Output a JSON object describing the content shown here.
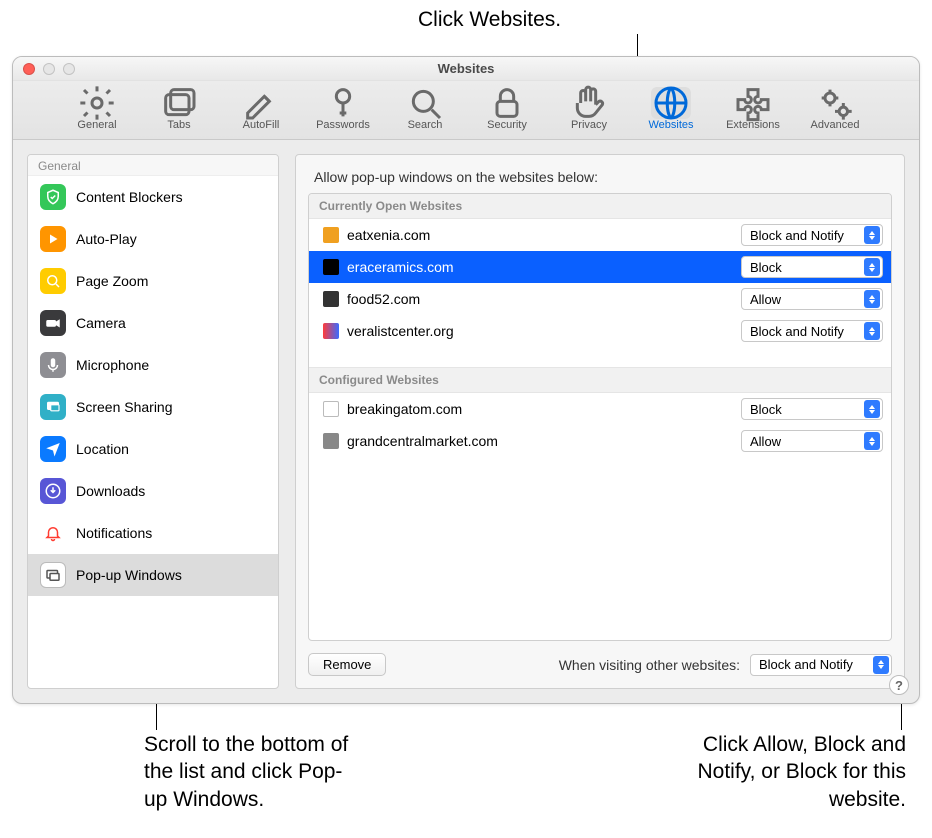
{
  "annotations": {
    "top": "Click Websites.",
    "bottom_left": "Scroll to the bottom of the list and click Pop-up Windows.",
    "bottom_right": "Click Allow, Block and Notify, or Block for this website."
  },
  "window": {
    "title": "Websites",
    "help_label": "?"
  },
  "toolbar": [
    {
      "id": "general",
      "label": "General"
    },
    {
      "id": "tabs",
      "label": "Tabs"
    },
    {
      "id": "autofill",
      "label": "AutoFill"
    },
    {
      "id": "passwords",
      "label": "Passwords"
    },
    {
      "id": "search",
      "label": "Search"
    },
    {
      "id": "security",
      "label": "Security"
    },
    {
      "id": "privacy",
      "label": "Privacy"
    },
    {
      "id": "websites",
      "label": "Websites",
      "active": true
    },
    {
      "id": "extensions",
      "label": "Extensions"
    },
    {
      "id": "advanced",
      "label": "Advanced"
    }
  ],
  "sidebar": {
    "header": "General",
    "items": [
      {
        "id": "content-blockers",
        "label": "Content Blockers",
        "color": "#34c759"
      },
      {
        "id": "auto-play",
        "label": "Auto-Play",
        "color": "#ff9500"
      },
      {
        "id": "page-zoom",
        "label": "Page Zoom",
        "color": "#ffcc00"
      },
      {
        "id": "camera",
        "label": "Camera",
        "color": "#3a3a3c"
      },
      {
        "id": "microphone",
        "label": "Microphone",
        "color": "#8e8e93"
      },
      {
        "id": "screen-sharing",
        "label": "Screen Sharing",
        "color": "#30b0c7"
      },
      {
        "id": "location",
        "label": "Location",
        "color": "#0a7aff"
      },
      {
        "id": "downloads",
        "label": "Downloads",
        "color": "#5856d6"
      },
      {
        "id": "notifications",
        "label": "Notifications",
        "color": "#ff3b30"
      },
      {
        "id": "popup-windows",
        "label": "Pop-up Windows",
        "color": "#d1d1d6",
        "selected": true
      }
    ]
  },
  "main": {
    "heading": "Allow pop-up windows on the websites below:",
    "sections": {
      "open_label": "Currently Open Websites",
      "configured_label": "Configured Websites"
    },
    "open_sites": [
      {
        "domain": "eatxenia.com",
        "policy": "Block and Notify",
        "favicon": "#f0a020"
      },
      {
        "domain": "eraceramics.com",
        "policy": "Block",
        "favicon": "#000",
        "selected": true
      },
      {
        "domain": "food52.com",
        "policy": "Allow",
        "favicon": "#333"
      },
      {
        "domain": "veralistcenter.org",
        "policy": "Block and Notify",
        "favicon": "linear-gradient(90deg,#ff3b3b,#3b6bff)"
      }
    ],
    "configured_sites": [
      {
        "domain": "breakingatom.com",
        "policy": "Block",
        "favicon": "#fff",
        "border": "#bbb"
      },
      {
        "domain": "grandcentralmarket.com",
        "policy": "Allow",
        "favicon": "#888"
      }
    ],
    "remove_label": "Remove",
    "other_label": "When visiting other websites:",
    "other_policy": "Block and Notify"
  }
}
